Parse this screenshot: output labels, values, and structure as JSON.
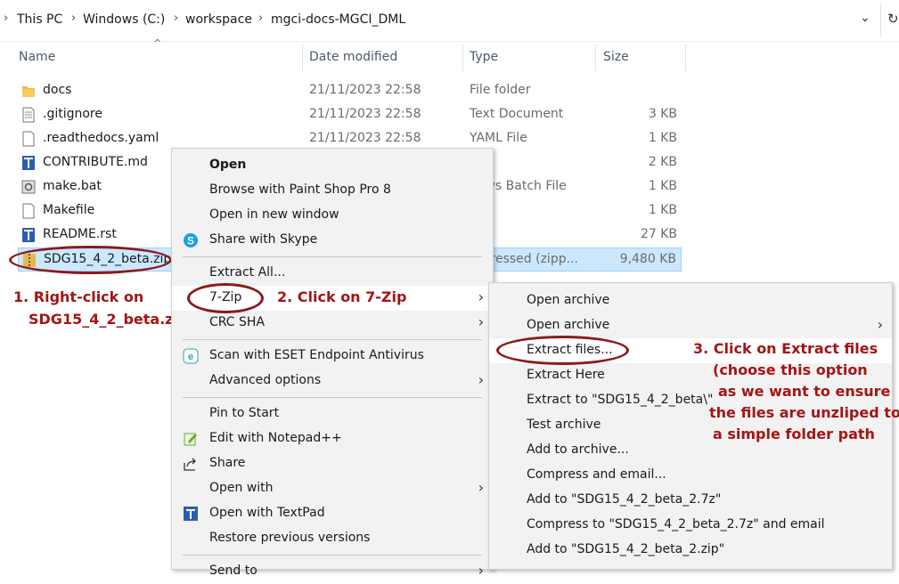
{
  "breadcrumb": [
    "This PC",
    "Windows (C:)",
    "workspace",
    "mgci-docs-MGCI_DML"
  ],
  "columns": {
    "name": "Name",
    "date": "Date modified",
    "type": "Type",
    "size": "Size"
  },
  "files": [
    {
      "name": "docs",
      "date": "21/11/2023 22:58",
      "type": "File folder",
      "size": "",
      "icon": "folder-icon"
    },
    {
      "name": ".gitignore",
      "date": "21/11/2023 22:58",
      "type": "Text Document",
      "size": "3 KB",
      "icon": "text-file-icon"
    },
    {
      "name": ".readthedocs.yaml",
      "date": "21/11/2023 22:58",
      "type": "YAML File",
      "size": "1 KB",
      "icon": "file-icon"
    },
    {
      "name": "CONTRIBUTE.md",
      "date": "",
      "type": "File",
      "size": "2 KB",
      "icon": "textpad-icon"
    },
    {
      "name": "make.bat",
      "date": "",
      "type": "dows Batch File",
      "size": "1 KB",
      "icon": "batch-file-icon"
    },
    {
      "name": "Makefile",
      "date": "",
      "type": "",
      "size": "1 KB",
      "icon": "file-icon"
    },
    {
      "name": "README.rst",
      "date": "",
      "type": "File",
      "size": "27 KB",
      "icon": "textpad-icon"
    },
    {
      "name": "SDG15_4_2_beta.zip",
      "date": "",
      "type": "mpressed (zipp...",
      "size": "9,480 KB",
      "icon": "zip-icon"
    }
  ],
  "context_menu": {
    "open": "Open",
    "browse_psp": "Browse with Paint Shop Pro 8",
    "open_new_window": "Open in new window",
    "share_skype": "Share with Skype",
    "extract_all": "Extract All...",
    "seven_zip": "7-Zip",
    "crc_sha": "CRC SHA",
    "scan_eset": "Scan with ESET Endpoint Antivirus",
    "advanced": "Advanced options",
    "pin_start": "Pin to Start",
    "edit_notepad": "Edit with Notepad++",
    "share": "Share",
    "open_with": "Open with",
    "open_textpad": "Open with TextPad",
    "restore": "Restore previous versions",
    "send_to": "Send to"
  },
  "submenu": [
    {
      "label": "Open archive",
      "arrow": false
    },
    {
      "label": "Open archive",
      "arrow": true
    },
    {
      "label": "Extract files...",
      "arrow": false
    },
    {
      "label": "Extract Here",
      "arrow": false
    },
    {
      "label": "Extract to \"SDG15_4_2_beta\\\"",
      "arrow": false
    },
    {
      "label": "Test archive",
      "arrow": false
    },
    {
      "label": "Add to archive...",
      "arrow": false
    },
    {
      "label": "Compress and email...",
      "arrow": false
    },
    {
      "label": "Add to \"SDG15_4_2_beta_2.7z\"",
      "arrow": false
    },
    {
      "label": "Compress to \"SDG15_4_2_beta_2.7z\" and email",
      "arrow": false
    },
    {
      "label": "Add to \"SDG15_4_2_beta_2.zip\"",
      "arrow": false
    }
  ],
  "annotations": {
    "step1_line1": "1. Right-click on",
    "step1_line2": "SDG15_4_2_beta.zip",
    "step2": "2. Click on 7-Zip",
    "step3_lines": [
      "3. Click on Extract files",
      "(choose this option",
      "as we want to ensure",
      "the files are unzliped to",
      "a simple folder path"
    ]
  },
  "colors": {
    "annotation": "#a31515",
    "selection": "#cce8ff",
    "menu_bg": "#f2f2f2"
  }
}
